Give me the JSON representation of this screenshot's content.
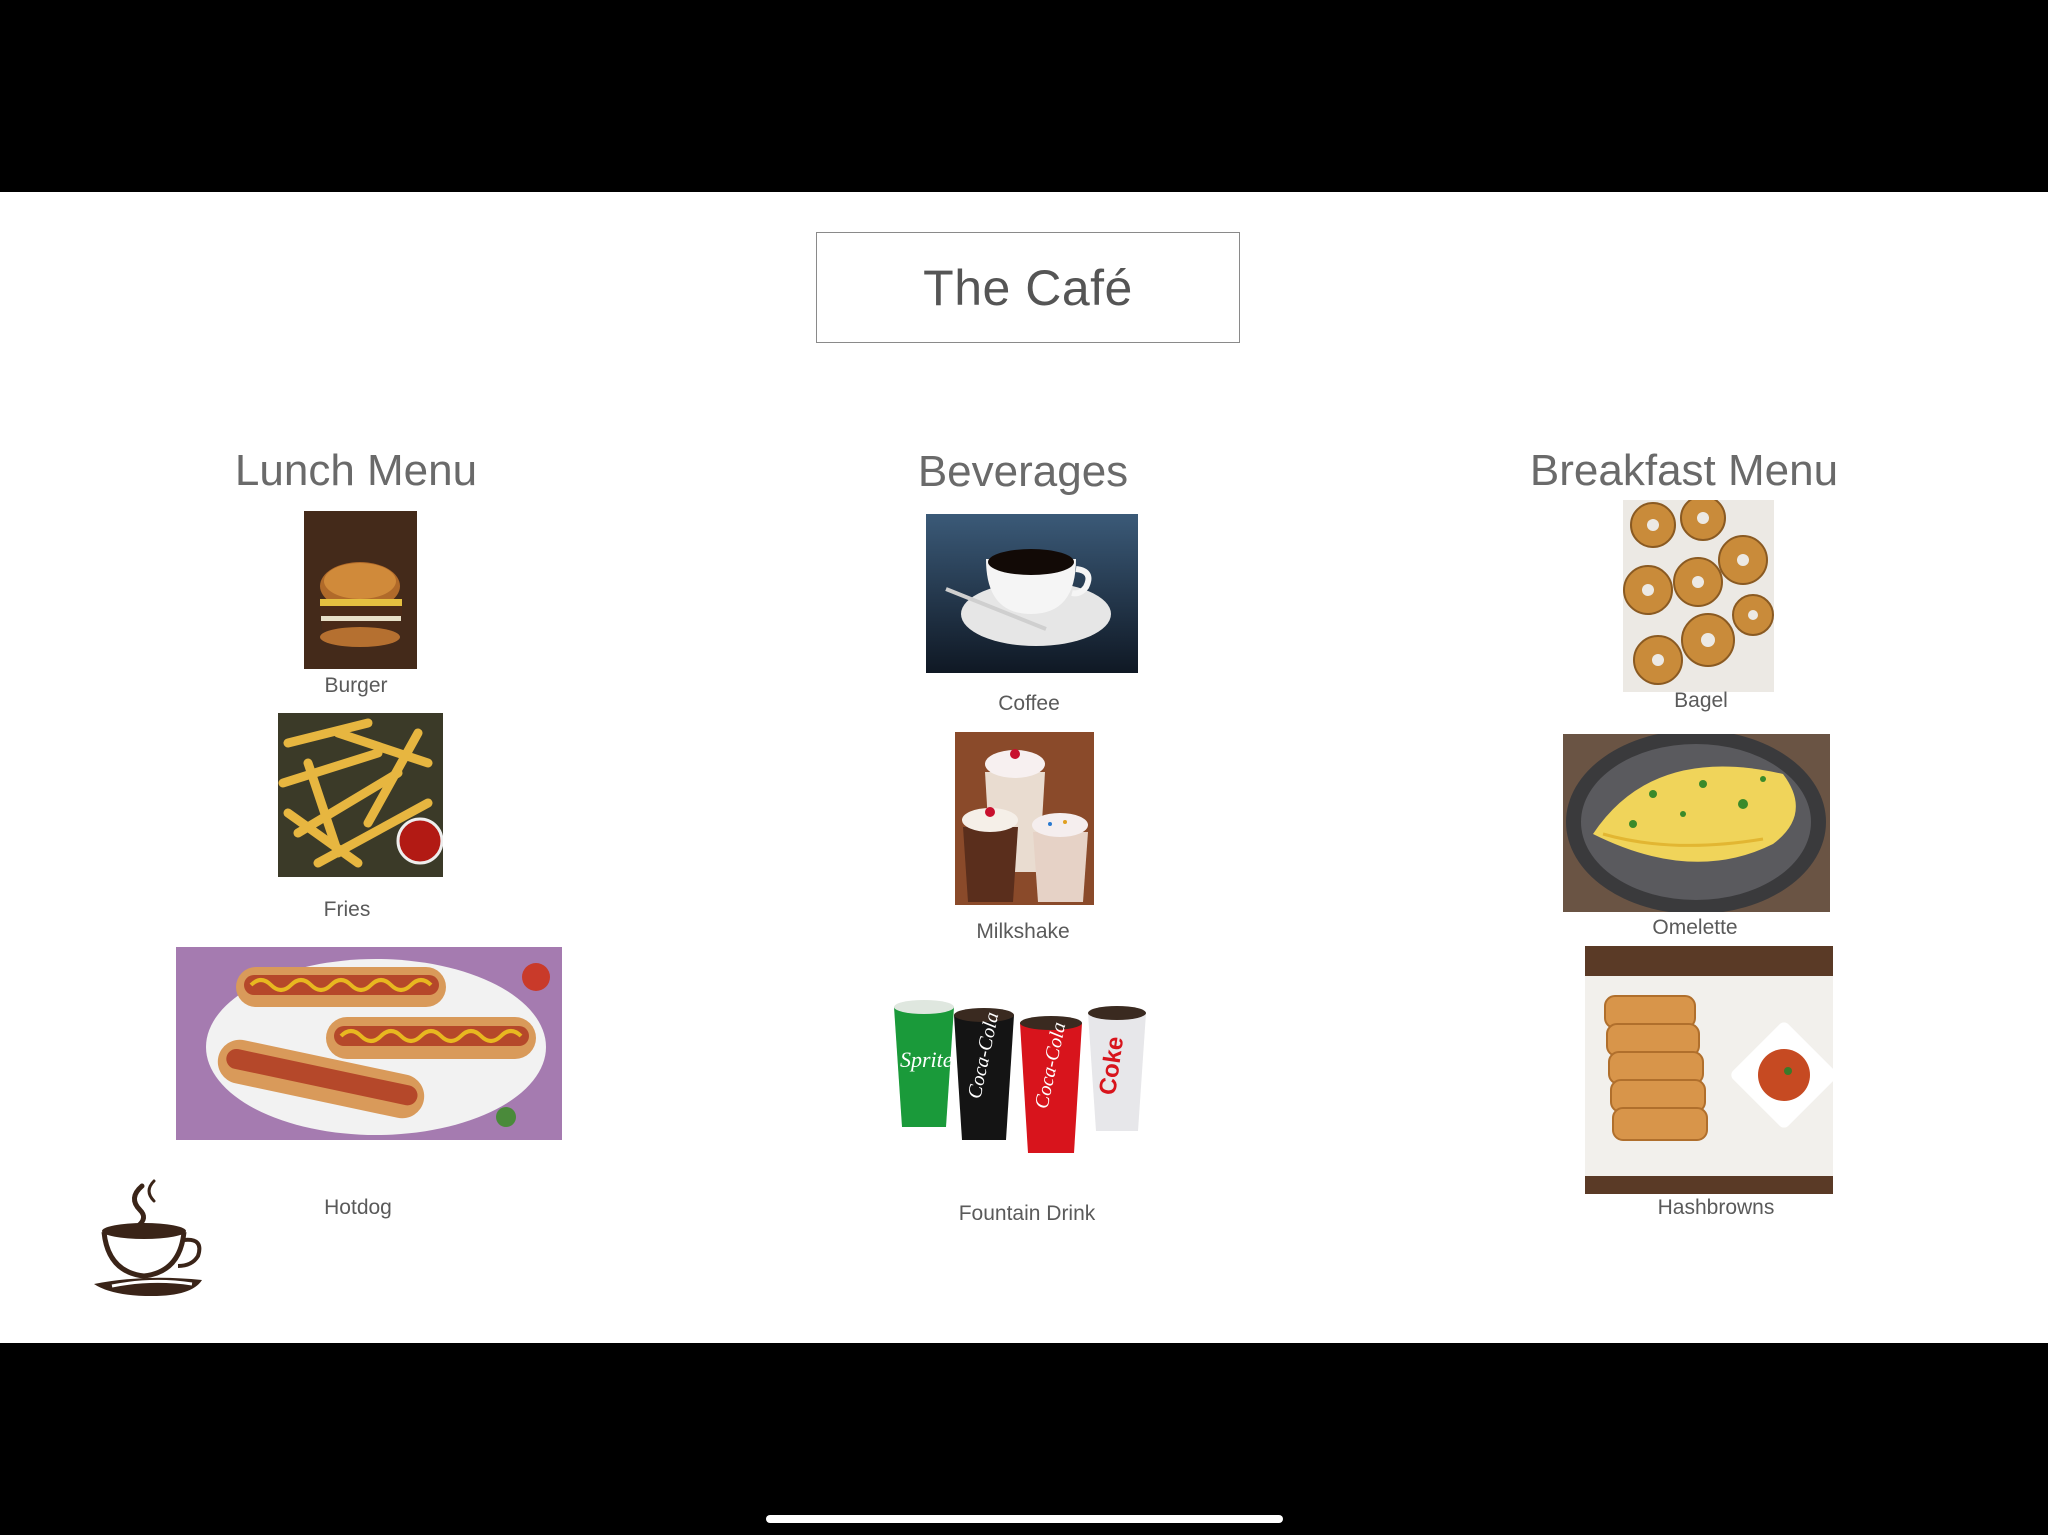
{
  "title": "The Café",
  "columns": {
    "lunch": {
      "heading": "Lunch Menu",
      "items": [
        {
          "label": "Burger",
          "image": "burger-photo"
        },
        {
          "label": "Fries",
          "image": "fries-photo"
        },
        {
          "label": "Hotdog",
          "image": "hotdog-photo"
        }
      ]
    },
    "beverages": {
      "heading": "Beverages",
      "items": [
        {
          "label": "Coffee",
          "image": "coffee-photo"
        },
        {
          "label": "Milkshake",
          "image": "milkshake-photo"
        },
        {
          "label": "Fountain Drink",
          "image": "fountain-drink-photo"
        }
      ]
    },
    "breakfast": {
      "heading": "Breakfast Menu",
      "items": [
        {
          "label": "Bagel",
          "image": "bagel-photo"
        },
        {
          "label": "Omelette",
          "image": "omelette-photo"
        },
        {
          "label": "Hashbrowns",
          "image": "hashbrowns-photo"
        }
      ]
    }
  },
  "logo": {
    "icon": "coffee-cup-icon"
  },
  "colors": {
    "background": "#000000",
    "slide": "#ffffff",
    "text": "#5a5a5a"
  }
}
